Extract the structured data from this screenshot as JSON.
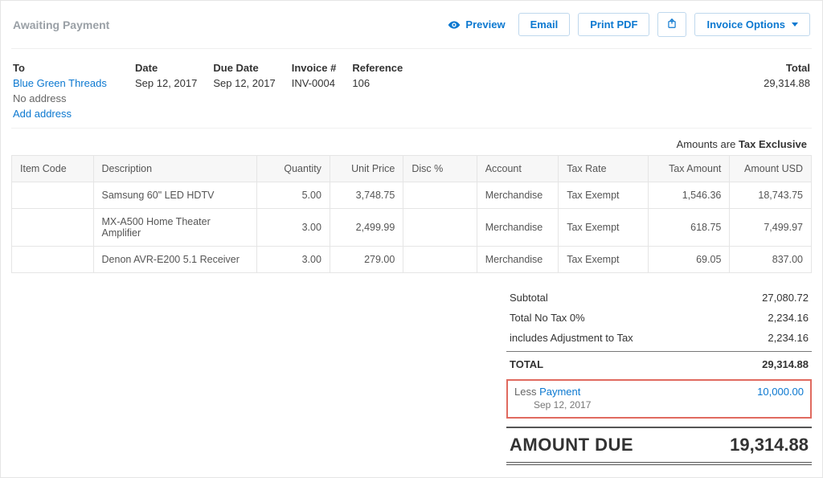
{
  "status": "Awaiting Payment",
  "header": {
    "preview": "Preview",
    "email": "Email",
    "print_pdf": "Print PDF",
    "invoice_options": "Invoice Options"
  },
  "meta": {
    "labels": {
      "to": "To",
      "date": "Date",
      "due_date": "Due Date",
      "invoice_no": "Invoice #",
      "reference": "Reference",
      "total": "Total"
    },
    "to_name": "Blue Green Threads",
    "to_no_address": "No address",
    "to_add_address": "Add address",
    "date": "Sep 12, 2017",
    "due_date": "Sep 12, 2017",
    "invoice_no": "INV-0004",
    "reference": "106",
    "total": "29,314.88"
  },
  "amounts_note_prefix": "Amounts are ",
  "amounts_note_strong": "Tax Exclusive",
  "columns": {
    "item_code": "Item Code",
    "description": "Description",
    "quantity": "Quantity",
    "unit_price": "Unit Price",
    "disc": "Disc %",
    "account": "Account",
    "tax_rate": "Tax Rate",
    "tax_amount": "Tax Amount",
    "amount": "Amount USD"
  },
  "lines": [
    {
      "item_code": "",
      "description": "Samsung 60\" LED HDTV",
      "quantity": "5.00",
      "unit_price": "3,748.75",
      "disc": "",
      "account": "Merchandise",
      "tax_rate": "Tax Exempt",
      "tax_amount": "1,546.36",
      "amount": "18,743.75"
    },
    {
      "item_code": "",
      "description": "MX-A500 Home Theater Amplifier",
      "quantity": "3.00",
      "unit_price": "2,499.99",
      "disc": "",
      "account": "Merchandise",
      "tax_rate": "Tax Exempt",
      "tax_amount": "618.75",
      "amount": "7,499.97"
    },
    {
      "item_code": "",
      "description": "Denon AVR-E200 5.1 Receiver",
      "quantity": "3.00",
      "unit_price": "279.00",
      "disc": "",
      "account": "Merchandise",
      "tax_rate": "Tax Exempt",
      "tax_amount": "69.05",
      "amount": "837.00"
    }
  ],
  "totals": {
    "subtotal_label": "Subtotal",
    "subtotal": "27,080.72",
    "no_tax_label": "Total No Tax 0%",
    "no_tax": "2,234.16",
    "adjustment_label": "includes Adjustment to Tax",
    "adjustment": "2,234.16",
    "total_label": "TOTAL",
    "total": "29,314.88",
    "less_label_prefix": "Less ",
    "less_link": "Payment",
    "less_amount": "10,000.00",
    "less_date": "Sep 12, 2017",
    "amount_due_label": "AMOUNT DUE",
    "amount_due": "19,314.88"
  }
}
